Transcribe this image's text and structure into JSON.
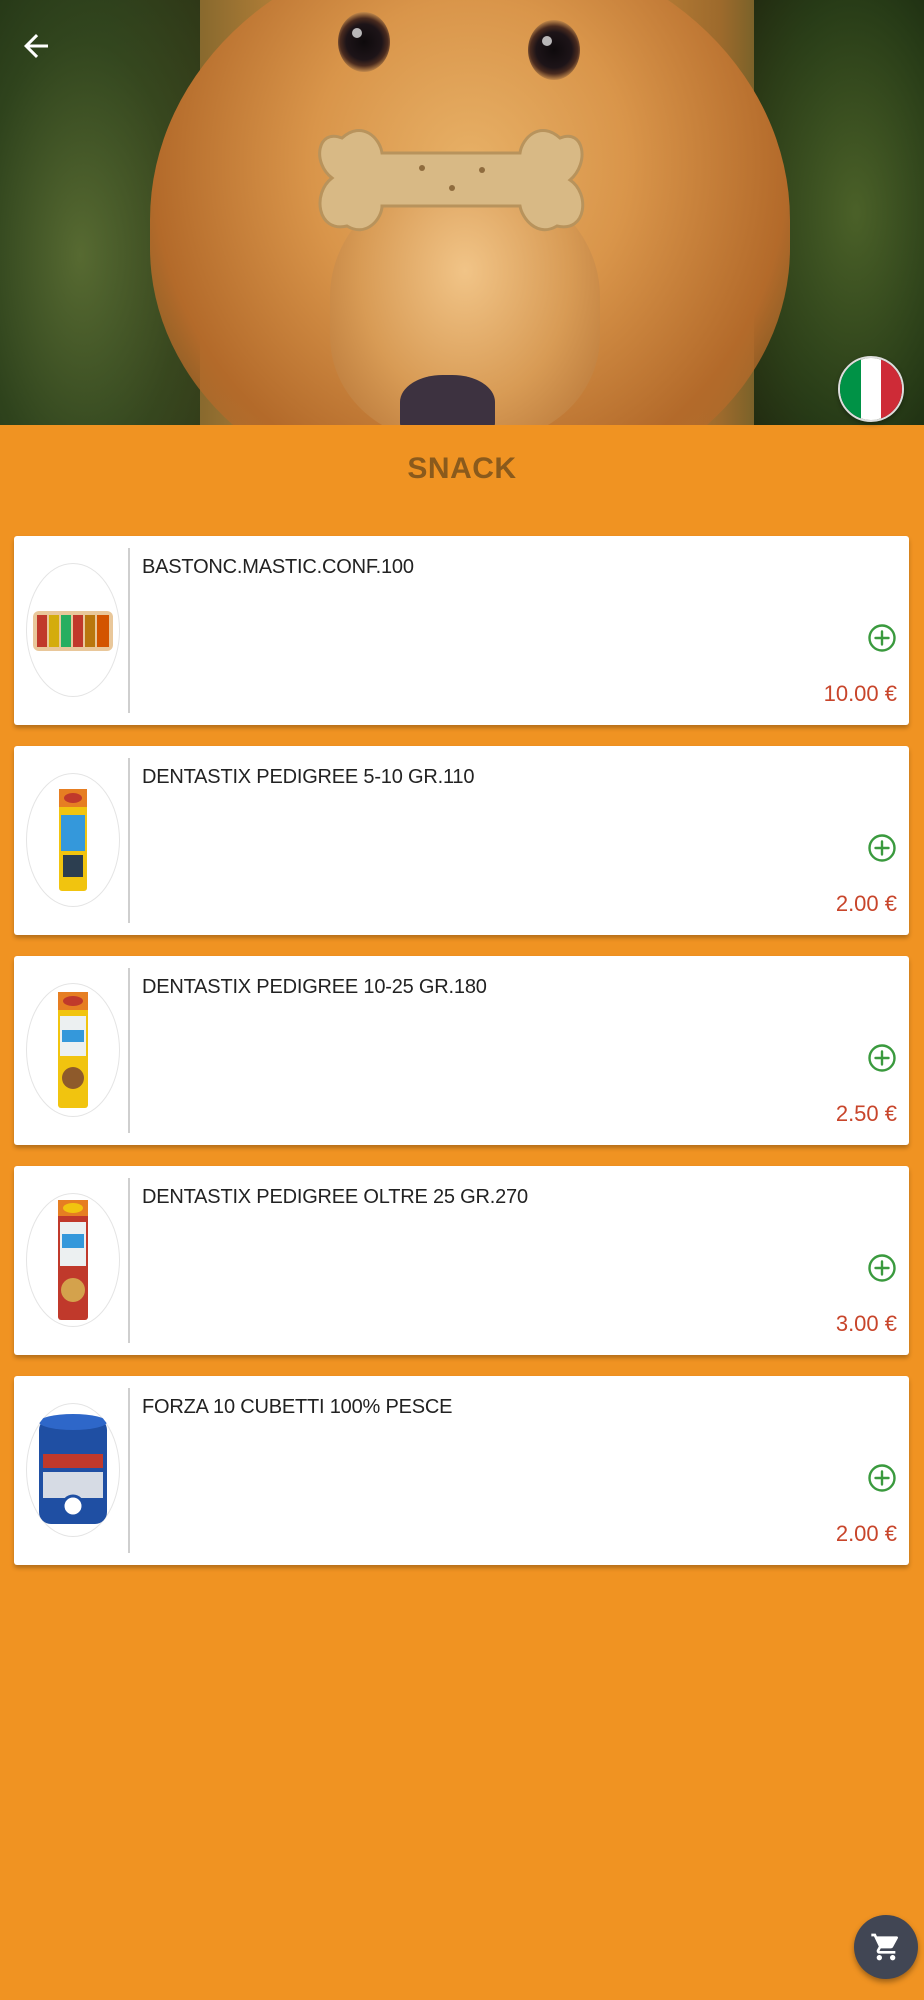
{
  "header": {
    "back_icon": "arrow-left-icon",
    "language_flag": "italy-flag-icon",
    "flag_colors": [
      "#009246",
      "#ffffff",
      "#ce2b37"
    ]
  },
  "category": {
    "title": "SNACK"
  },
  "products": [
    {
      "name": "BASTONC.MASTIC.CONF.100",
      "price": "10.00 €",
      "add_icon": "plus-circle-icon"
    },
    {
      "name": "DENTASTIX PEDIGREE 5-10 GR.110",
      "price": "2.00 €",
      "add_icon": "plus-circle-icon"
    },
    {
      "name": "DENTASTIX PEDIGREE 10-25 GR.180",
      "price": "2.50 €",
      "add_icon": "plus-circle-icon"
    },
    {
      "name": "DENTASTIX PEDIGREE OLTRE 25 GR.270",
      "price": "3.00 €",
      "add_icon": "plus-circle-icon"
    },
    {
      "name": "FORZA 10 CUBETTI 100% PESCE",
      "price": "2.00 €",
      "add_icon": "plus-circle-icon"
    }
  ],
  "cart": {
    "icon": "shopping-cart-icon"
  },
  "colors": {
    "background": "#f09322",
    "title": "#8a5a1c",
    "price": "#c8452b",
    "add_icon": "#3a9a3e",
    "cart_fab": "#414654"
  }
}
